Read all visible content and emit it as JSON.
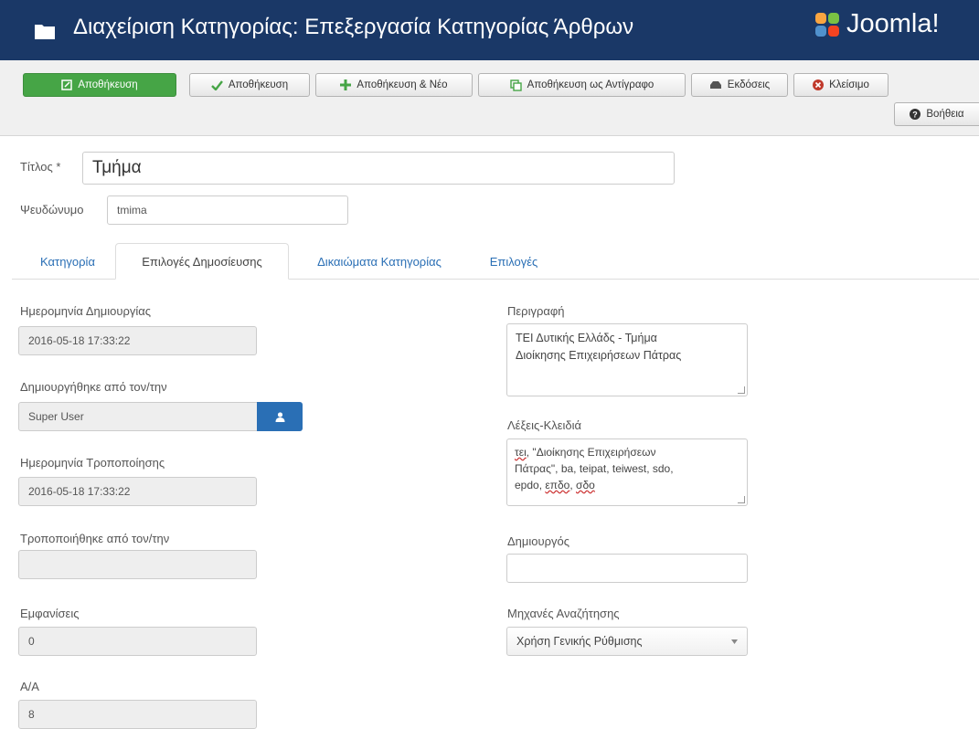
{
  "header": {
    "title": "Διαχείριση Κατηγορίας: Επεξεργασία Κατηγορίας Άρθρων",
    "brand": "Joomla!"
  },
  "toolbar": {
    "save_label": "Αποθήκευση",
    "save_close_label": "Αποθήκευση",
    "save_new_label": "Αποθήκευση & Νέο",
    "save_copy_label": "Αποθήκευση ως Αντίγραφο",
    "versions_label": "Εκδόσεις",
    "close_label": "Κλείσιμο",
    "help_label": "Βοήθεια"
  },
  "form": {
    "title_label": "Τίτλος *",
    "title_value": "Τμήμα",
    "alias_label": "Ψευδώνυμο",
    "alias_value": "tmima"
  },
  "tabs": [
    {
      "label": "Κατηγορία"
    },
    {
      "label": "Επιλογές Δημοσίευσης"
    },
    {
      "label": "Δικαιώματα Κατηγορίας"
    },
    {
      "label": "Επιλογές"
    }
  ],
  "left": {
    "created_date_label": "Ημερομηνία Δημιουργίας",
    "created_date_value": "2016-05-18 17:33:22",
    "created_by_label": "Δημιουργήθηκε από τον/την",
    "created_by_value": "Super User",
    "modified_date_label": "Ημερομηνία Τροποποίησης",
    "modified_date_value": "2016-05-18 17:33:22",
    "modified_by_label": "Τροποποιήθηκε από τον/την",
    "modified_by_value": "",
    "hits_label": "Εμφανίσεις",
    "hits_value": "0",
    "id_label": "Α/Α",
    "id_value": "8"
  },
  "right": {
    "description_label": "Περιγραφή",
    "description_line1": "ΤΕΙ Δυτικής Ελλάδς - Τμήμα",
    "description_line2": "Διοίκησης Επιχειρήσεων Πάτρας",
    "keywords_label": "Λέξεις-Κλειδιά",
    "kw_tei": "τει",
    "kw_rest1": ", \"Διοίκησης Επιχειρήσεων",
    "kw_line2": "Πάτρας\", ba, teipat, teiwest, sdo,",
    "kw_line3a": "epdo, ",
    "kw_epido": "επδο",
    "kw_comma": ", ",
    "kw_sdo": "σδο",
    "author_label": "Δημιουργός",
    "author_value": "",
    "robots_label": "Μηχανές Αναζήτησης",
    "robots_value": "Χρήση Γενικής Ρύθμισης"
  },
  "colors": {
    "header_bg": "#1a3867",
    "save_green": "#46a546",
    "link_blue": "#2a6fb5",
    "user_button": "#2a6fb5",
    "close_red": "#c0392b"
  }
}
